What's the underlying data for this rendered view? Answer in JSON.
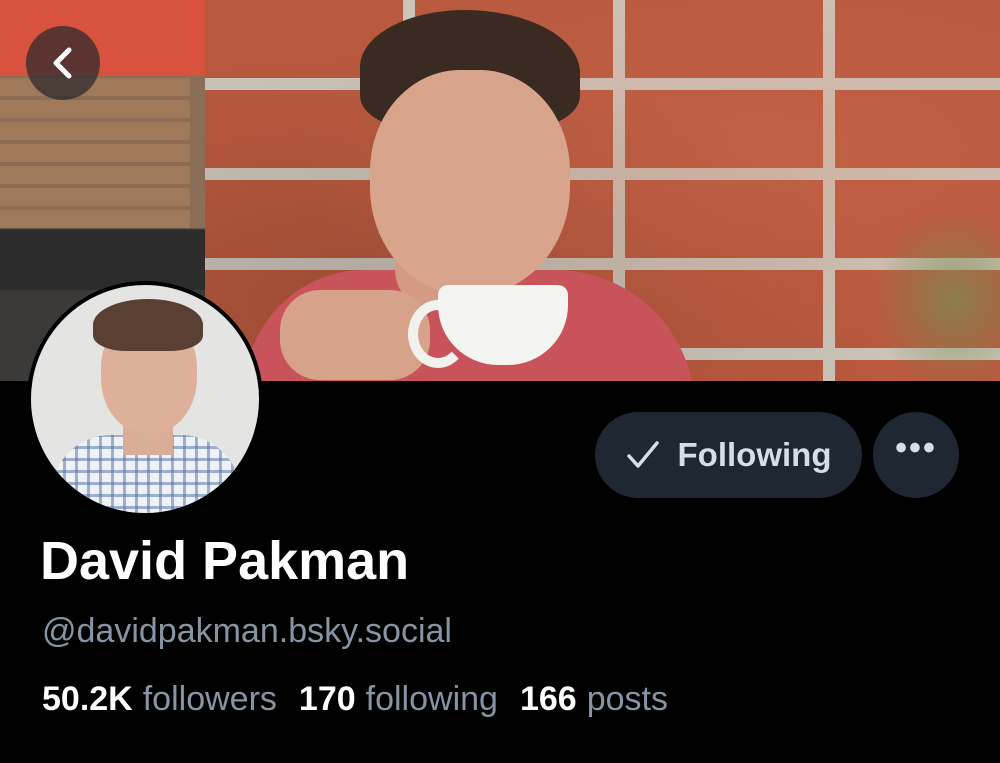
{
  "profile": {
    "display_name": "David Pakman",
    "handle": "@davidpakman.bsky.social"
  },
  "actions": {
    "following_label": "Following",
    "more_label": "•••"
  },
  "stats": {
    "followers_count": "50.2K",
    "followers_label": "followers",
    "following_count": "170",
    "following_label": "following",
    "posts_count": "166",
    "posts_label": "posts"
  },
  "colors": {
    "background": "#000000",
    "button_bg": "#1e2732",
    "muted_text": "#8794a3",
    "primary_text": "#ffffff"
  },
  "icons": {
    "back": "chevron-left-icon",
    "following": "check-icon",
    "more": "ellipsis-icon"
  }
}
